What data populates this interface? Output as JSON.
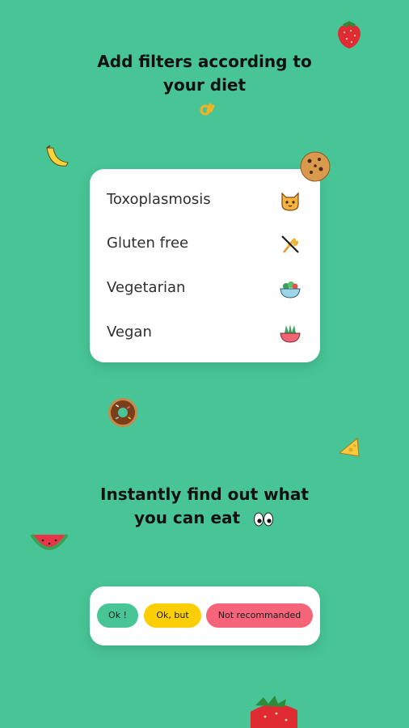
{
  "headline_filters": {
    "line1": "Add filters according to",
    "line2": "your diet"
  },
  "filters": [
    {
      "label": "Toxoplasmosis",
      "icon": "cat-face-icon"
    },
    {
      "label": "Gluten free",
      "icon": "no-wheat-icon"
    },
    {
      "label": "Vegetarian",
      "icon": "salad-bowl-icon"
    },
    {
      "label": "Vegan",
      "icon": "vegan-bowl-icon"
    }
  ],
  "headline_find": {
    "line1": "Instantly find out what",
    "line2": "you can eat"
  },
  "statuses": {
    "ok": "Ok !",
    "ok_but": "Ok, but",
    "not_recommended": "Not recommanded"
  },
  "colors": {
    "background": "#48c597",
    "ok": "#48c597",
    "ok_but": "#fcce06",
    "not_recommended": "#f6647a"
  }
}
